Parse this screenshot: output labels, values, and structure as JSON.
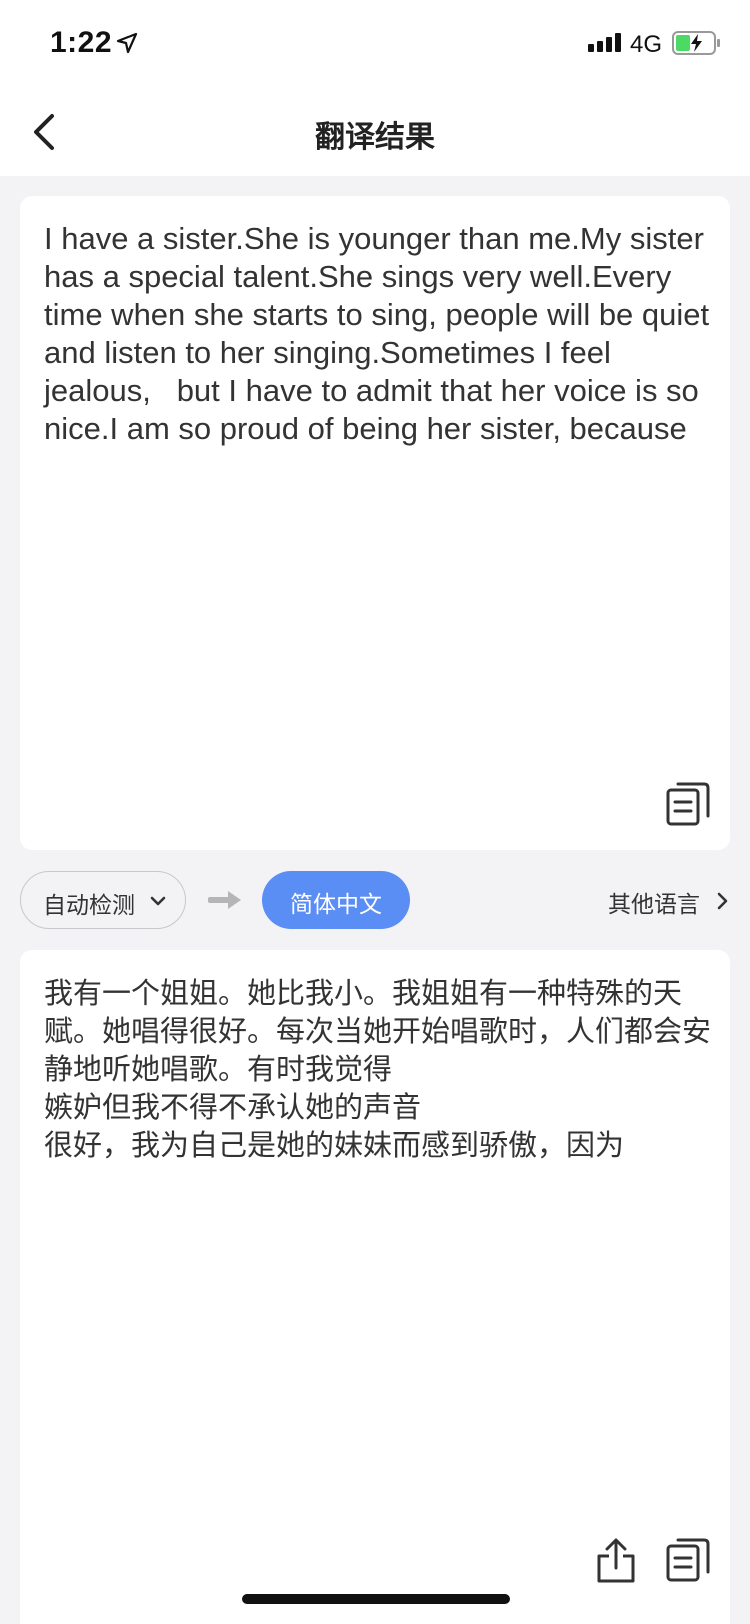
{
  "status_bar": {
    "time": "1:22",
    "network": "4G",
    "location_icon": "location-arrow-icon",
    "signal_icon": "signal-bars-icon",
    "battery_icon": "battery-charging-icon"
  },
  "nav": {
    "title": "翻译结果",
    "back_icon": "chevron-left-icon"
  },
  "source": {
    "text": "I have a sister.She is younger than me.My sister has a special talent.She sings very well.Every time when she starts to sing, people will be quiet and listen to her singing.Sometimes I feel\njealous,   but I have to admit that her voice is so\nnice.I am so proud of being her sister, because",
    "copy_icon": "copy-icon"
  },
  "language_bar": {
    "source_lang": "自动检测",
    "target_lang": "简体中文",
    "other_languages": "其他语言",
    "colors": {
      "target_pill": "#5b8ef5"
    }
  },
  "translation": {
    "text": "我有一个姐姐。她比我小。我姐姐有一种特殊的天赋。她唱得很好。每次当她开始唱歌时，人们都会安静地听她唱歌。有时我觉得\n嫉妒但我不得不承认她的声音\n很好，我为自己是她的妹妹而感到骄傲，因为",
    "share_icon": "share-icon",
    "copy_icon": "copy-icon"
  }
}
